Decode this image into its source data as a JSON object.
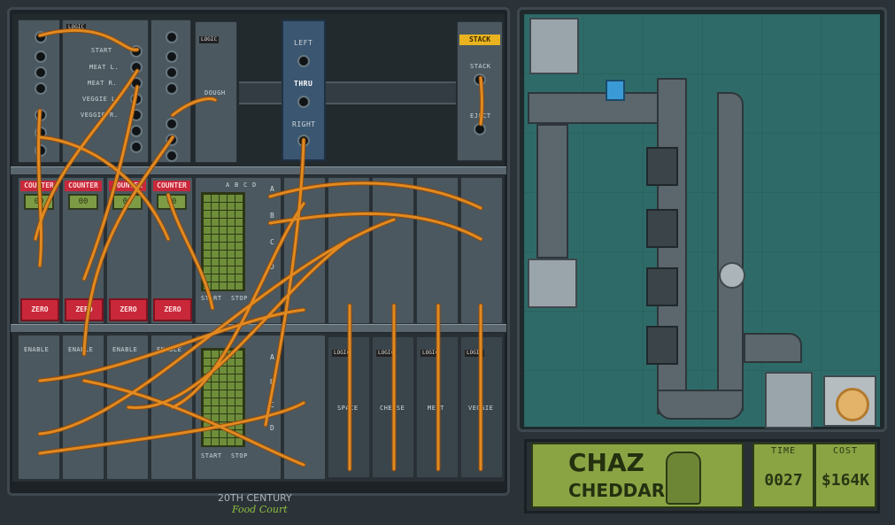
{
  "window": {
    "footer_line1": "20TH CENTURY",
    "footer_line2": "Food Court"
  },
  "logic_labels": {
    "top_left": "LOGIC",
    "dough_head": "LOGIC",
    "space_head": "LOGIC",
    "cheese_head": "LOGIC",
    "meat_head": "LOGIC",
    "veggie_head": "LOGIC"
  },
  "sequencer": {
    "items": [
      "START",
      "MEAT L.",
      "MEAT R.",
      "VEGGIE L.",
      "VEGGIE R."
    ]
  },
  "modules": {
    "dough": "DOUGH",
    "stack": "STACK",
    "stack_in": "STACK",
    "eject": "EJECT",
    "space": "SPACE",
    "cheese": "CHEESE",
    "meat": "MEAT",
    "veggie": "VEGGIE"
  },
  "router": {
    "left": "LEFT",
    "thru": "THRU",
    "right": "RIGHT"
  },
  "counters": {
    "label": "COUNTER",
    "values": [
      "00",
      "00",
      "00",
      "00"
    ],
    "zero": "ZERO",
    "enable": "ENABLE"
  },
  "grid_top": {
    "cols": [
      "A",
      "B",
      "C",
      "D"
    ],
    "start": "START",
    "stop": "STOP"
  },
  "grid_bottom": {
    "start": "START",
    "stop": "STOP"
  },
  "channels": [
    "A",
    "B",
    "C",
    "D"
  ],
  "hud": {
    "name_line1": "CHAZ",
    "name_line2": "CHEDDAR",
    "time_label": "TIME",
    "time_value": "0027",
    "cost_label": "COST",
    "cost_value": "$164K"
  },
  "colors": {
    "wire": "#e08a22",
    "wire_dark": "#8a4a10",
    "panel": "#4b585f",
    "red": "#c8283a",
    "lcd": "#8aa444",
    "floor": "#2e6b68"
  }
}
